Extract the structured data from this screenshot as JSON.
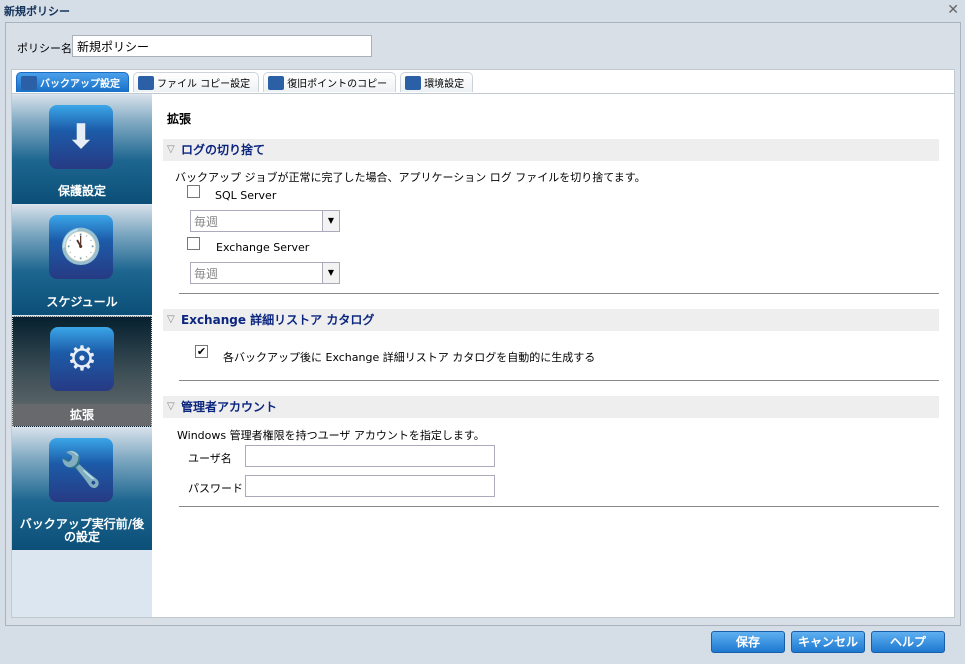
{
  "window": {
    "title": "新規ポリシー"
  },
  "policy_name": {
    "label": "ポリシー名:",
    "value": "新規ポリシー"
  },
  "tabs": [
    {
      "label": "バックアップ設定"
    },
    {
      "label": "ファイル コピー設定"
    },
    {
      "label": "復旧ポイントのコピー"
    },
    {
      "label": "環境設定"
    }
  ],
  "sidebar": {
    "items": [
      {
        "label": "保護設定"
      },
      {
        "label": "スケジュール"
      },
      {
        "label": "拡張"
      },
      {
        "label": "バックアップ実行前/後の設定"
      }
    ]
  },
  "main": {
    "title": "拡張",
    "log_truncation": {
      "header": "ログの切り捨て",
      "description": "バックアップ ジョブが正常に完了した場合、アプリケーション ログ ファイルを切り捨てます。",
      "sql": {
        "label": "SQL Server",
        "checked": false,
        "frequency": "毎週"
      },
      "exchange": {
        "label": "Exchange Server",
        "checked": false,
        "frequency": "毎週"
      }
    },
    "catalog": {
      "header": "Exchange 詳細リストア カタログ",
      "option": "各バックアップ後に Exchange 詳細リストア カタログを自動的に生成する",
      "checked": true,
      "check_mark": "✔"
    },
    "admin": {
      "header": "管理者アカウント",
      "description": "Windows 管理者権限を持つユーザ アカウントを指定します。",
      "user_label": "ユーザ名",
      "user_value": "",
      "password_label": "パスワード",
      "password_value": ""
    }
  },
  "buttons": {
    "save": "保存",
    "cancel": "キャンセル",
    "help": "ヘルプ"
  }
}
